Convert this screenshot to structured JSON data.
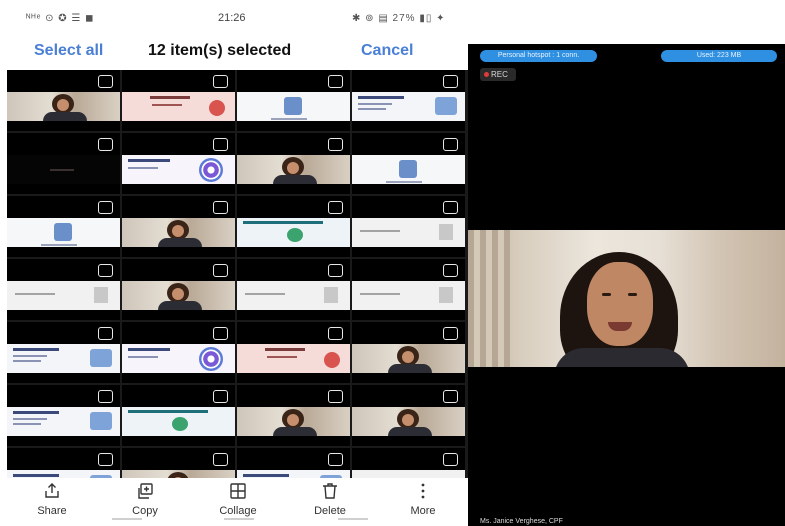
{
  "status_bar": {
    "left": "ᴺᴴᵉ ⊙ ✪ ☰ ◼",
    "time": "21:26",
    "right": "✱ ⊚ ▤ 27% ▮▯ ✦"
  },
  "header": {
    "select_all": "Select all",
    "selection_count": "12 item(s) selected",
    "cancel": "Cancel"
  },
  "grid": {
    "items": [
      {
        "kind": "face"
      },
      {
        "kind": "pink"
      },
      {
        "kind": "cloud"
      },
      {
        "kind": "slide"
      },
      {
        "kind": "dark"
      },
      {
        "kind": "target"
      },
      {
        "kind": "face"
      },
      {
        "kind": "cloud"
      },
      {
        "kind": "cloud"
      },
      {
        "kind": "face"
      },
      {
        "kind": "blue"
      },
      {
        "kind": "plain"
      },
      {
        "kind": "plain"
      },
      {
        "kind": "face"
      },
      {
        "kind": "plain"
      },
      {
        "kind": "plain"
      },
      {
        "kind": "slide"
      },
      {
        "kind": "target"
      },
      {
        "kind": "pink"
      },
      {
        "kind": "face"
      },
      {
        "kind": "slide"
      },
      {
        "kind": "blue"
      },
      {
        "kind": "face"
      },
      {
        "kind": "face"
      },
      {
        "kind": "slide"
      },
      {
        "kind": "face"
      },
      {
        "kind": "slide"
      },
      {
        "kind": "white"
      }
    ]
  },
  "actions": [
    {
      "label": "Share",
      "icon": "share-icon"
    },
    {
      "label": "Copy",
      "icon": "copy-icon"
    },
    {
      "label": "Collage",
      "icon": "collage-icon"
    },
    {
      "label": "Delete",
      "icon": "delete-icon"
    },
    {
      "label": "More",
      "icon": "more-icon"
    }
  ],
  "video_panel": {
    "personal_hotspot": "Personal hotspot : 1 conn.",
    "used": "Used: 223 MB",
    "rec": "REC",
    "speaker_name": "Ms. Janice Verghese, CPF"
  },
  "colors": {
    "accent_blue": "#4a7fd6",
    "pill_blue": "#2f8fe0",
    "rec_red": "#e03a3a"
  }
}
